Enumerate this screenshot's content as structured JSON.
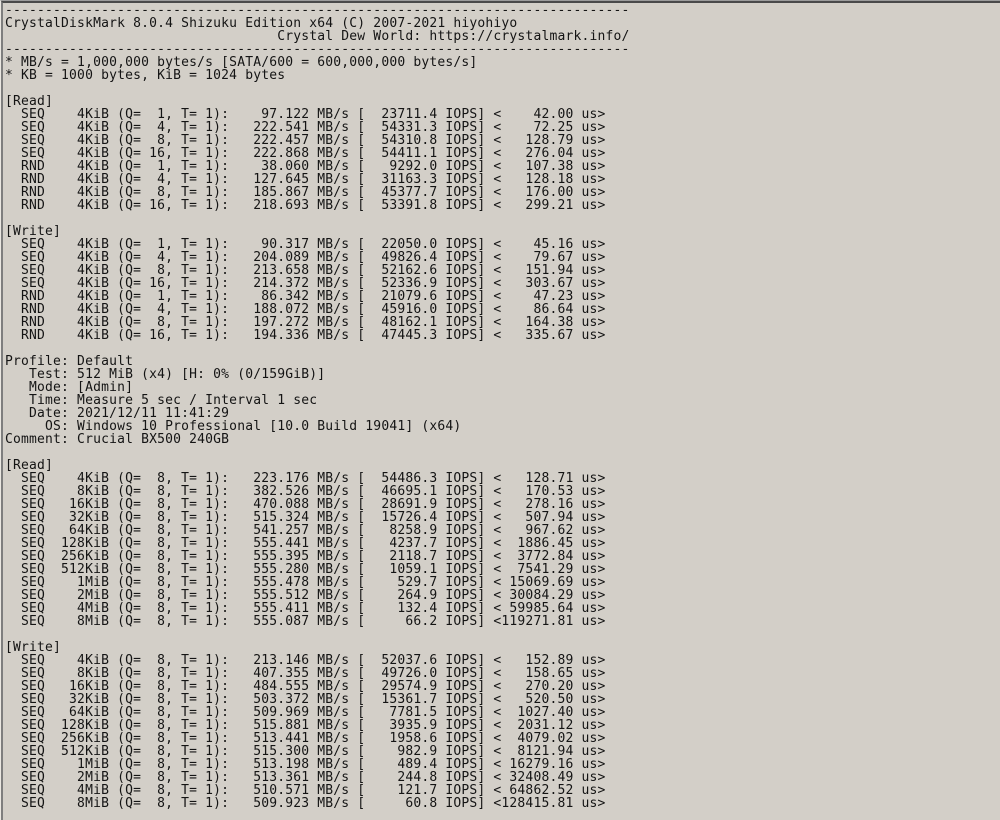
{
  "app": {
    "name": "CrystalDiskMark",
    "version": "8.0.4",
    "edition": "Shizuku Edition x64"
  },
  "header": {
    "divider": "------------------------------------------------------------------------------",
    "line_width": 78,
    "title_line": "CrystalDiskMark 8.0.4 Shizuku Edition x64 (C) 2007-2021 hiyohiyo",
    "subtitle_line": "Crystal Dew World: https://crystalmark.info/"
  },
  "notes": [
    "* MB/s = 1,000,000 bytes/s [SATA/600 = 600,000,000 bytes/s]",
    "* KB = 1000 bytes, KiB = 1024 bytes"
  ],
  "sections": [
    {
      "label": "[Read]",
      "rows": [
        {
          "type": "SEQ",
          "size": "4KiB",
          "q": 1,
          "t": 1,
          "mbps": "97.122",
          "iops": "23711.4",
          "latency_us": "42.00"
        },
        {
          "type": "SEQ",
          "size": "4KiB",
          "q": 4,
          "t": 1,
          "mbps": "222.541",
          "iops": "54331.3",
          "latency_us": "72.25"
        },
        {
          "type": "SEQ",
          "size": "4KiB",
          "q": 8,
          "t": 1,
          "mbps": "222.457",
          "iops": "54310.8",
          "latency_us": "128.79"
        },
        {
          "type": "SEQ",
          "size": "4KiB",
          "q": 16,
          "t": 1,
          "mbps": "222.868",
          "iops": "54411.1",
          "latency_us": "276.04"
        },
        {
          "type": "RND",
          "size": "4KiB",
          "q": 1,
          "t": 1,
          "mbps": "38.060",
          "iops": "9292.0",
          "latency_us": "107.38"
        },
        {
          "type": "RND",
          "size": "4KiB",
          "q": 4,
          "t": 1,
          "mbps": "127.645",
          "iops": "31163.3",
          "latency_us": "128.18"
        },
        {
          "type": "RND",
          "size": "4KiB",
          "q": 8,
          "t": 1,
          "mbps": "185.867",
          "iops": "45377.7",
          "latency_us": "176.00"
        },
        {
          "type": "RND",
          "size": "4KiB",
          "q": 16,
          "t": 1,
          "mbps": "218.693",
          "iops": "53391.8",
          "latency_us": "299.21"
        }
      ]
    },
    {
      "label": "[Write]",
      "rows": [
        {
          "type": "SEQ",
          "size": "4KiB",
          "q": 1,
          "t": 1,
          "mbps": "90.317",
          "iops": "22050.0",
          "latency_us": "45.16"
        },
        {
          "type": "SEQ",
          "size": "4KiB",
          "q": 4,
          "t": 1,
          "mbps": "204.089",
          "iops": "49826.4",
          "latency_us": "79.67"
        },
        {
          "type": "SEQ",
          "size": "4KiB",
          "q": 8,
          "t": 1,
          "mbps": "213.658",
          "iops": "52162.6",
          "latency_us": "151.94"
        },
        {
          "type": "SEQ",
          "size": "4KiB",
          "q": 16,
          "t": 1,
          "mbps": "214.372",
          "iops": "52336.9",
          "latency_us": "303.67"
        },
        {
          "type": "RND",
          "size": "4KiB",
          "q": 1,
          "t": 1,
          "mbps": "86.342",
          "iops": "21079.6",
          "latency_us": "47.23"
        },
        {
          "type": "RND",
          "size": "4KiB",
          "q": 4,
          "t": 1,
          "mbps": "188.072",
          "iops": "45916.0",
          "latency_us": "86.64"
        },
        {
          "type": "RND",
          "size": "4KiB",
          "q": 8,
          "t": 1,
          "mbps": "197.272",
          "iops": "48162.1",
          "latency_us": "164.38"
        },
        {
          "type": "RND",
          "size": "4KiB",
          "q": 16,
          "t": 1,
          "mbps": "194.336",
          "iops": "47445.3",
          "latency_us": "335.67"
        }
      ]
    },
    {
      "label": "[Read]",
      "rows": [
        {
          "type": "SEQ",
          "size": "4KiB",
          "q": 8,
          "t": 1,
          "mbps": "223.176",
          "iops": "54486.3",
          "latency_us": "128.71"
        },
        {
          "type": "SEQ",
          "size": "8KiB",
          "q": 8,
          "t": 1,
          "mbps": "382.526",
          "iops": "46695.1",
          "latency_us": "170.53"
        },
        {
          "type": "SEQ",
          "size": "16KiB",
          "q": 8,
          "t": 1,
          "mbps": "470.088",
          "iops": "28691.9",
          "latency_us": "278.16"
        },
        {
          "type": "SEQ",
          "size": "32KiB",
          "q": 8,
          "t": 1,
          "mbps": "515.324",
          "iops": "15726.4",
          "latency_us": "507.94"
        },
        {
          "type": "SEQ",
          "size": "64KiB",
          "q": 8,
          "t": 1,
          "mbps": "541.257",
          "iops": "8258.9",
          "latency_us": "967.62"
        },
        {
          "type": "SEQ",
          "size": "128KiB",
          "q": 8,
          "t": 1,
          "mbps": "555.441",
          "iops": "4237.7",
          "latency_us": "1886.45"
        },
        {
          "type": "SEQ",
          "size": "256KiB",
          "q": 8,
          "t": 1,
          "mbps": "555.395",
          "iops": "2118.7",
          "latency_us": "3772.84"
        },
        {
          "type": "SEQ",
          "size": "512KiB",
          "q": 8,
          "t": 1,
          "mbps": "555.280",
          "iops": "1059.1",
          "latency_us": "7541.29"
        },
        {
          "type": "SEQ",
          "size": "1MiB",
          "q": 8,
          "t": 1,
          "mbps": "555.478",
          "iops": "529.7",
          "latency_us": "15069.69"
        },
        {
          "type": "SEQ",
          "size": "2MiB",
          "q": 8,
          "t": 1,
          "mbps": "555.512",
          "iops": "264.9",
          "latency_us": "30084.29"
        },
        {
          "type": "SEQ",
          "size": "4MiB",
          "q": 8,
          "t": 1,
          "mbps": "555.411",
          "iops": "132.4",
          "latency_us": "59985.64"
        },
        {
          "type": "SEQ",
          "size": "8MiB",
          "q": 8,
          "t": 1,
          "mbps": "555.087",
          "iops": "66.2",
          "latency_us": "119271.81"
        }
      ]
    },
    {
      "label": "[Write]",
      "rows": [
        {
          "type": "SEQ",
          "size": "4KiB",
          "q": 8,
          "t": 1,
          "mbps": "213.146",
          "iops": "52037.6",
          "latency_us": "152.89"
        },
        {
          "type": "SEQ",
          "size": "8KiB",
          "q": 8,
          "t": 1,
          "mbps": "407.355",
          "iops": "49726.0",
          "latency_us": "158.65"
        },
        {
          "type": "SEQ",
          "size": "16KiB",
          "q": 8,
          "t": 1,
          "mbps": "484.555",
          "iops": "29574.9",
          "latency_us": "270.20"
        },
        {
          "type": "SEQ",
          "size": "32KiB",
          "q": 8,
          "t": 1,
          "mbps": "503.372",
          "iops": "15361.7",
          "latency_us": "520.50"
        },
        {
          "type": "SEQ",
          "size": "64KiB",
          "q": 8,
          "t": 1,
          "mbps": "509.969",
          "iops": "7781.5",
          "latency_us": "1027.40"
        },
        {
          "type": "SEQ",
          "size": "128KiB",
          "q": 8,
          "t": 1,
          "mbps": "515.881",
          "iops": "3935.9",
          "latency_us": "2031.12"
        },
        {
          "type": "SEQ",
          "size": "256KiB",
          "q": 8,
          "t": 1,
          "mbps": "513.441",
          "iops": "1958.6",
          "latency_us": "4079.02"
        },
        {
          "type": "SEQ",
          "size": "512KiB",
          "q": 8,
          "t": 1,
          "mbps": "515.300",
          "iops": "982.9",
          "latency_us": "8121.94"
        },
        {
          "type": "SEQ",
          "size": "1MiB",
          "q": 8,
          "t": 1,
          "mbps": "513.198",
          "iops": "489.4",
          "latency_us": "16279.16"
        },
        {
          "type": "SEQ",
          "size": "2MiB",
          "q": 8,
          "t": 1,
          "mbps": "513.361",
          "iops": "244.8",
          "latency_us": "32408.49"
        },
        {
          "type": "SEQ",
          "size": "4MiB",
          "q": 8,
          "t": 1,
          "mbps": "510.571",
          "iops": "121.7",
          "latency_us": "64862.52"
        },
        {
          "type": "SEQ",
          "size": "8MiB",
          "q": 8,
          "t": 1,
          "mbps": "509.923",
          "iops": "60.8",
          "latency_us": "128415.81"
        }
      ]
    }
  ],
  "profile": [
    {
      "key": "Profile",
      "value": "Default"
    },
    {
      "key": "Test",
      "value": "512 MiB (x4) [H: 0% (0/159GiB)]"
    },
    {
      "key": "Mode",
      "value": "[Admin]"
    },
    {
      "key": "Time",
      "value": "Measure 5 sec / Interval 1 sec"
    },
    {
      "key": "Date",
      "value": "2021/12/11 11:41:29"
    },
    {
      "key": "OS",
      "value": "Windows 10 Professional [10.0 Build 19041] (x64)"
    },
    {
      "key": "Comment",
      "value": "Crucial BX500 240GB"
    }
  ],
  "colors": {
    "bg": "#d3cfc8",
    "fg": "#141414",
    "edge_top_hi": "#9c9c9c",
    "edge_top_dark": "#4a4a4a",
    "edge_left_hi": "#eae7e1",
    "edge_left_dark": "#7e7e7e"
  }
}
